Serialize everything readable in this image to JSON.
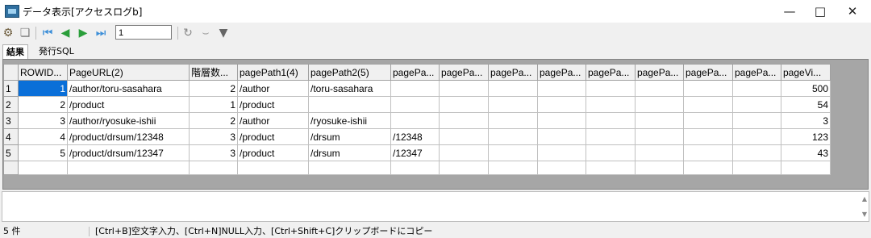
{
  "window": {
    "title": "データ表示[アクセスログb]"
  },
  "toolbar": {
    "record_value": "1"
  },
  "tabs": [
    {
      "label": "結果"
    },
    {
      "label": "発行SQL"
    }
  ],
  "grid": {
    "columns": [
      "ROWID...",
      "PageURL(2)",
      "階層数...",
      "pagePath1(4)",
      "pagePath2(5)",
      "pagePa...",
      "pagePa...",
      "pagePa...",
      "pagePa...",
      "pagePa...",
      "pagePa...",
      "pagePa...",
      "pagePa...",
      "pageVi..."
    ],
    "rows": [
      {
        "num": "1",
        "cells": [
          "1",
          "/author/toru-sasahara",
          "2",
          "/author",
          "/toru-sasahara",
          "",
          "",
          "",
          "",
          "",
          "",
          "",
          "",
          "500"
        ]
      },
      {
        "num": "2",
        "cells": [
          "2",
          "/product",
          "1",
          "/product",
          "",
          "",
          "",
          "",
          "",
          "",
          "",
          "",
          "",
          "54"
        ]
      },
      {
        "num": "3",
        "cells": [
          "3",
          "/author/ryosuke-ishii",
          "2",
          "/author",
          "/ryosuke-ishii",
          "",
          "",
          "",
          "",
          "",
          "",
          "",
          "",
          "3"
        ]
      },
      {
        "num": "4",
        "cells": [
          "4",
          "/product/drsum/12348",
          "3",
          "/product",
          "/drsum",
          "/12348",
          "",
          "",
          "",
          "",
          "",
          "",
          "",
          "123"
        ]
      },
      {
        "num": "5",
        "cells": [
          "5",
          "/product/drsum/12347",
          "3",
          "/product",
          "/drsum",
          "/12347",
          "",
          "",
          "",
          "",
          "",
          "",
          "",
          "43"
        ]
      }
    ],
    "selected_color": "#0a6fd8"
  },
  "status": {
    "count": "5 件",
    "hint": "[Ctrl+B]空文字入力、[Ctrl+N]NULL入力、[Ctrl+Shift+C]クリップボードにコピー"
  }
}
